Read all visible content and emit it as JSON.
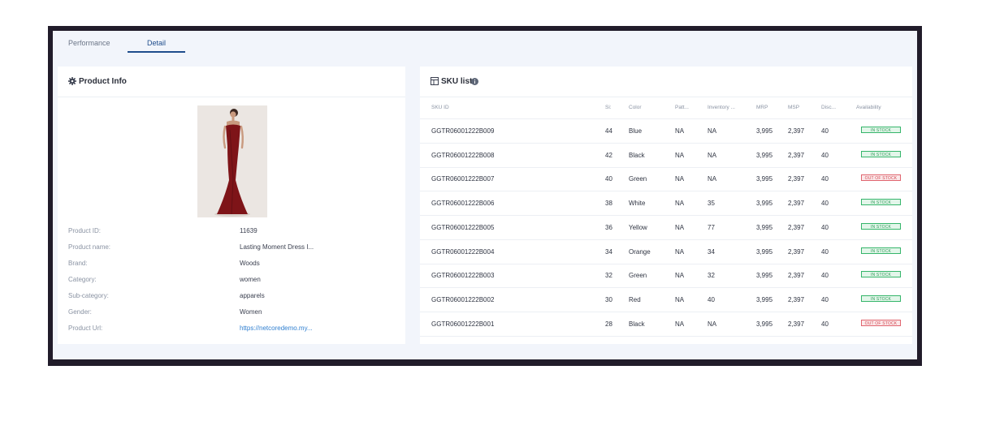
{
  "tabs": [
    {
      "label": "Performance",
      "active": false
    },
    {
      "label": "Detail",
      "active": true
    }
  ],
  "product_info": {
    "title": "Product Info",
    "icon": "gear-icon",
    "fields": [
      {
        "label": "Product ID:",
        "value": "11639"
      },
      {
        "label": "Product name:",
        "value": "Lasting Moment Dress I..."
      },
      {
        "label": "Brand:",
        "value": "Woods"
      },
      {
        "label": "Category:",
        "value": "women"
      },
      {
        "label": "Sub-category:",
        "value": "apparels"
      },
      {
        "label": "Gender:",
        "value": "Women"
      },
      {
        "label": "Product Url:",
        "value": "https://netcoredemo.my..."
      }
    ]
  },
  "sku_list": {
    "title": "SKU list",
    "columns": [
      "SKU ID",
      "Si:",
      "Color",
      "Patt...",
      "Inventory ...",
      "MRP",
      "MSP",
      "Disc...",
      "Availability"
    ],
    "rows": [
      [
        "GGTR06001222B009",
        "44",
        "Blue",
        "NA",
        "NA",
        "3,995",
        "2,397",
        "40",
        "IN STOCK"
      ],
      [
        "GGTR06001222B008",
        "42",
        "Black",
        "NA",
        "NA",
        "3,995",
        "2,397",
        "40",
        "IN STOCK"
      ],
      [
        "GGTR06001222B007",
        "40",
        "Green",
        "NA",
        "NA",
        "3,995",
        "2,397",
        "40",
        "OUT OF STOCK"
      ],
      [
        "GGTR06001222B006",
        "38",
        "White",
        "NA",
        "35",
        "3,995",
        "2,397",
        "40",
        "IN STOCK"
      ],
      [
        "GGTR06001222B005",
        "36",
        "Yellow",
        "NA",
        "77",
        "3,995",
        "2,397",
        "40",
        "IN STOCK"
      ],
      [
        "GGTR06001222B004",
        "34",
        "Orange",
        "NA",
        "34",
        "3,995",
        "2,397",
        "40",
        "IN STOCK"
      ],
      [
        "GGTR06001222B003",
        "32",
        "Green",
        "NA",
        "32",
        "3,995",
        "2,397",
        "40",
        "IN STOCK"
      ],
      [
        "GGTR06001222B002",
        "30",
        "Red",
        "NA",
        "40",
        "3,995",
        "2,397",
        "40",
        "IN STOCK"
      ],
      [
        "GGTR06001222B001",
        "28",
        "Black",
        "NA",
        "NA",
        "3,995",
        "2,397",
        "40",
        "OUT OF STOCK"
      ]
    ]
  },
  "colors": {
    "accent": "#1f4d8c",
    "in_stock": "#35b56a",
    "out_of_stock": "#e0656f"
  }
}
